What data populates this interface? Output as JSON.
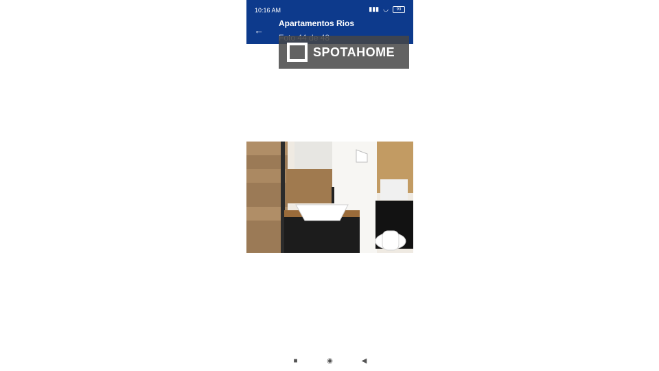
{
  "status_bar": {
    "time": "10:16 AM",
    "icons_text": "⟲ S",
    "battery": "93"
  },
  "appbar": {
    "title": "Apartamentos Rios",
    "subtitle": "Foto 44 de 48",
    "back_icon": "arrow-left-icon"
  },
  "overlay": {
    "logo_text": "SPOTAHOME"
  },
  "photo": {
    "description": "bathroom"
  },
  "navbar": {
    "recents": "■",
    "home": "◉",
    "back": "◀"
  },
  "colors": {
    "appbar": "#0d3a8c"
  }
}
